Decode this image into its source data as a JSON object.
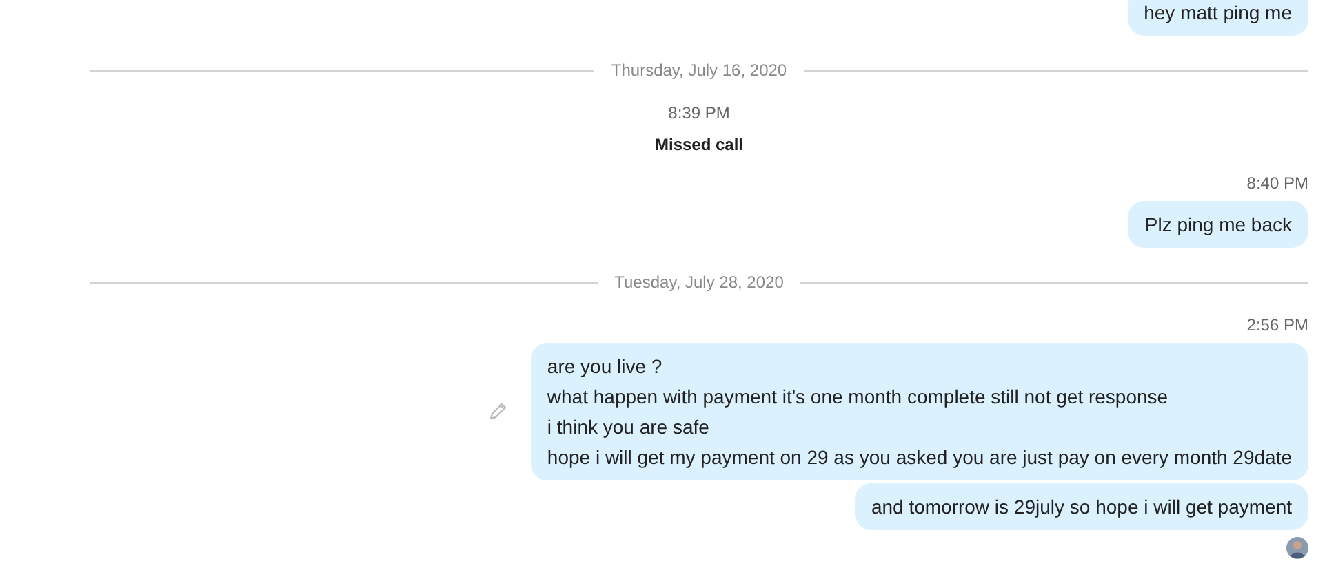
{
  "items": [
    {
      "kind": "message",
      "lines": [
        "hey matt ping me"
      ],
      "cut": true
    },
    {
      "kind": "divider",
      "label": "Thursday, July 16, 2020"
    },
    {
      "kind": "call",
      "time": "8:39 PM",
      "label": "Missed call"
    },
    {
      "kind": "time",
      "label": "8:40 PM"
    },
    {
      "kind": "message",
      "lines": [
        "Plz ping me back"
      ]
    },
    {
      "kind": "divider",
      "label": "Tuesday, July 28, 2020"
    },
    {
      "kind": "time",
      "label": "2:56 PM"
    },
    {
      "kind": "message",
      "edited": true,
      "lines": [
        "are you live ?",
        "what happen with payment it's one month complete still not get response",
        "i think you are safe",
        "hope i will get my payment on 29 as you asked you are just pay on every month 29date"
      ]
    },
    {
      "kind": "message",
      "lines": [
        "and tomorrow is 29july so hope i will get payment"
      ]
    },
    {
      "kind": "avatar"
    }
  ]
}
